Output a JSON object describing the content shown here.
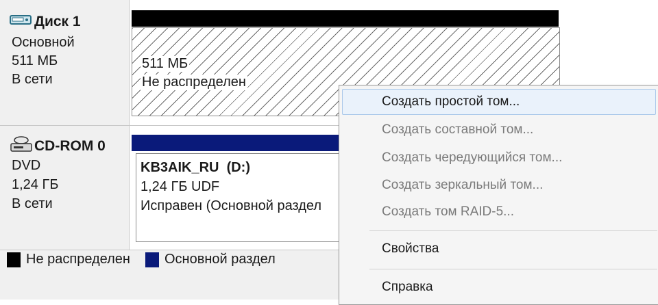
{
  "disks": [
    {
      "name": "Диск 1",
      "icon": "hard-drive-icon",
      "type": "Основной",
      "size": "511 МБ",
      "status": "В сети",
      "partition": {
        "size": "511 МБ",
        "status": "Не распределен"
      }
    },
    {
      "name": "CD-ROM 0",
      "icon": "cd-drive-icon",
      "type": "DVD",
      "size": "1,24 ГБ",
      "status": "В сети",
      "partition": {
        "label": "KB3AIK_RU  (D:)",
        "size_fs": "1,24 ГБ UDF",
        "status": "Исправен (Основной раздел"
      }
    }
  ],
  "legend": [
    {
      "label": "Не распределен",
      "color": "#000000"
    },
    {
      "label": "Основной раздел",
      "color": "#0a1a7a"
    }
  ],
  "context_menu": {
    "items": [
      {
        "label": "Создать простой том...",
        "enabled": true,
        "highlighted": true
      },
      {
        "label": "Создать составной том...",
        "enabled": false
      },
      {
        "label": "Создать чередующийся том...",
        "enabled": false
      },
      {
        "label": "Создать зеркальный том...",
        "enabled": false
      },
      {
        "label": "Создать том RAID-5...",
        "enabled": false
      },
      {
        "label": "Свойства",
        "enabled": true
      },
      {
        "label": "Справка",
        "enabled": true
      }
    ]
  }
}
